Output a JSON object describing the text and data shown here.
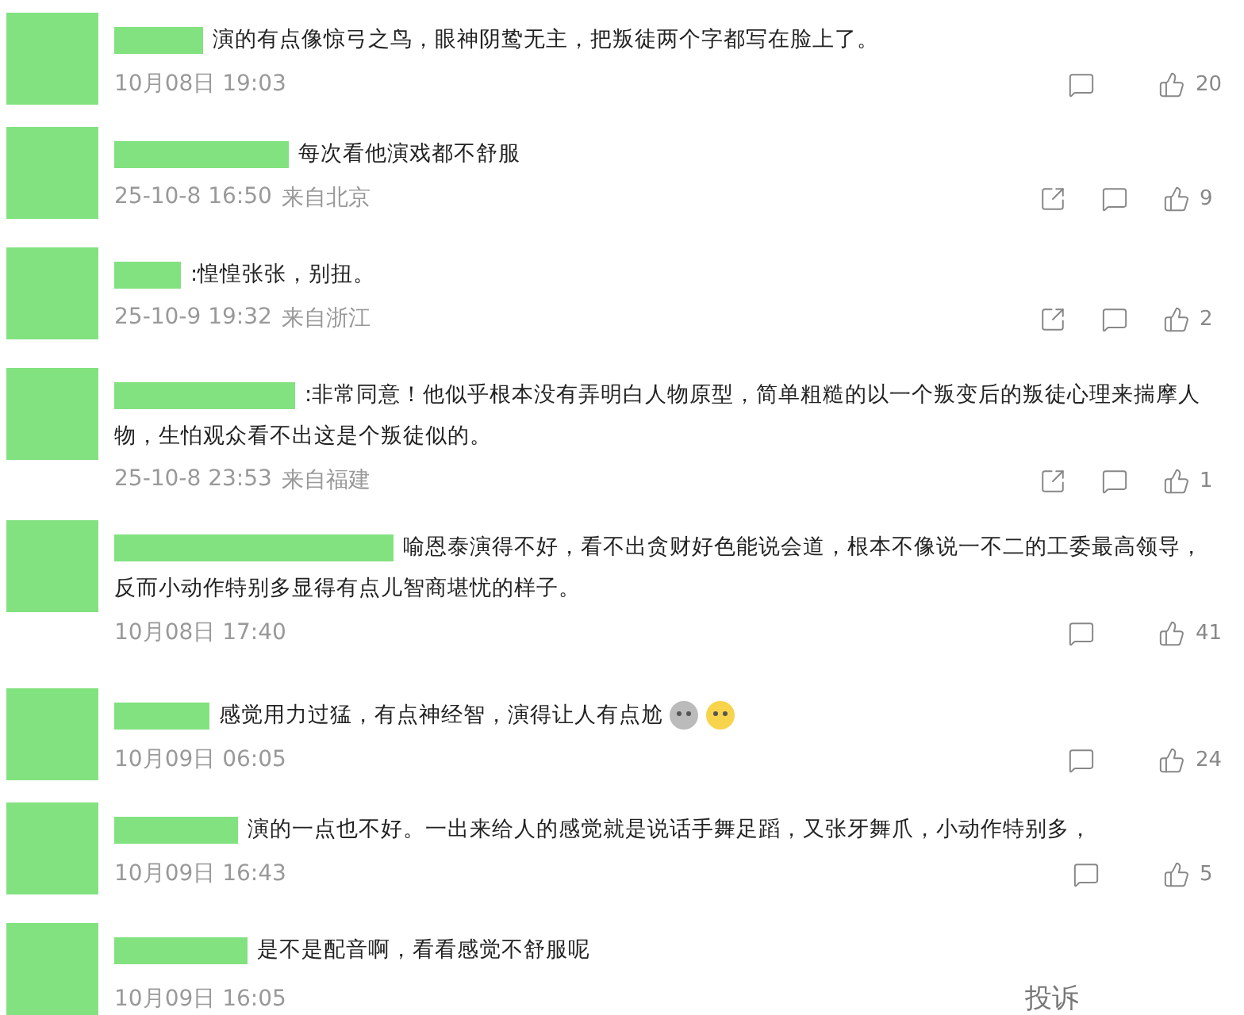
{
  "comments": [
    {
      "kind": "web",
      "text": "演的有点像惊弓之鸟，眼神阴鸷无主，把叛徒两个字都写在脸上了。",
      "time": "10月08日 19:03",
      "likes": "20"
    },
    {
      "kind": "app",
      "text": "每次看他演戏都不舒服",
      "time": "25-10-8 16:50",
      "location": "来自北京",
      "likes": "9"
    },
    {
      "kind": "app",
      "text": ":惶惶张张，别扭。",
      "time": "25-10-9 19:32",
      "location": "来自浙江",
      "likes": "2"
    },
    {
      "kind": "app",
      "text": ":非常同意！他似乎根本没有弄明白人物原型，简单粗糙的以一个叛变后的叛徒心理来揣摩人物，生怕观众看不出这是个叛徒似的。",
      "time": "25-10-8 23:53",
      "location": "来自福建",
      "likes": "1"
    },
    {
      "kind": "web",
      "text": "喻恩泰演得不好，看不出贪财好色能说会道，根本不像说一不二的工委最高领导，反而小动作特别多显得有点儿智商堪忧的样子。",
      "time": "10月08日 17:40",
      "likes": "41"
    },
    {
      "kind": "web",
      "text": "感觉用力过猛，有点神经智，演得让人有点尬",
      "emojis": [
        {
          "kind": "dizzy"
        },
        {
          "kind": "awkward"
        }
      ],
      "time": "10月09日 06:05",
      "likes": "24"
    },
    {
      "kind": "web",
      "text": "演的一点也不好。一出来给人的感觉就是说话手舞足蹈，又张牙舞爪，小动作特别多，",
      "time": "10月09日 16:43",
      "likes": "5"
    },
    {
      "kind": "web",
      "text": "是不是配音啊，看看感觉不舒服呢",
      "time": "10月09日 16:05",
      "report": "投诉"
    }
  ]
}
